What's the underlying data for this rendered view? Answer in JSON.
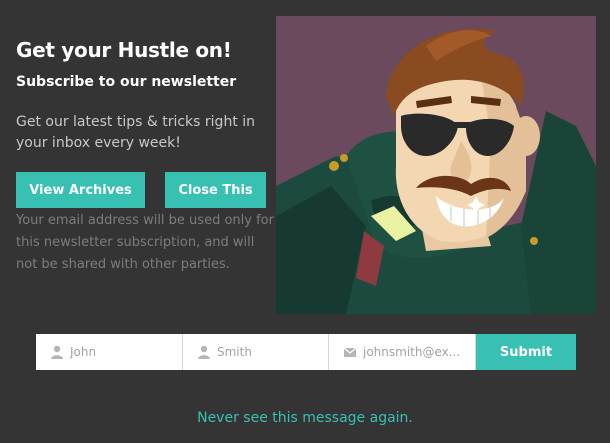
{
  "popup": {
    "title": "Get your Hustle on!",
    "subtitle": "Subscribe to our newsletter",
    "description": "Get our latest tips & tricks right in your inbox every week!",
    "privacy_note": "Your email address will be used only for this newsletter subscription, and will not be shared with other parties.",
    "buttons": {
      "view_archives": "View Archives",
      "close_this": "Close This"
    },
    "hero_image": {
      "subject": "cartoon-hustler-character",
      "background_color": "#6b4a5d"
    }
  },
  "form": {
    "first_name": {
      "placeholder": "John",
      "icon": "user-icon"
    },
    "last_name": {
      "placeholder": "Smith",
      "icon": "user-icon"
    },
    "email": {
      "placeholder": "johnsmith@ex...",
      "icon": "envelope-icon"
    },
    "submit_label": "Submit"
  },
  "footer": {
    "never_see_again": "Never see this message again."
  },
  "colors": {
    "background": "#343434",
    "accent": "#38c1b2",
    "text": "#ffffff",
    "muted": "#7d7d7d"
  }
}
